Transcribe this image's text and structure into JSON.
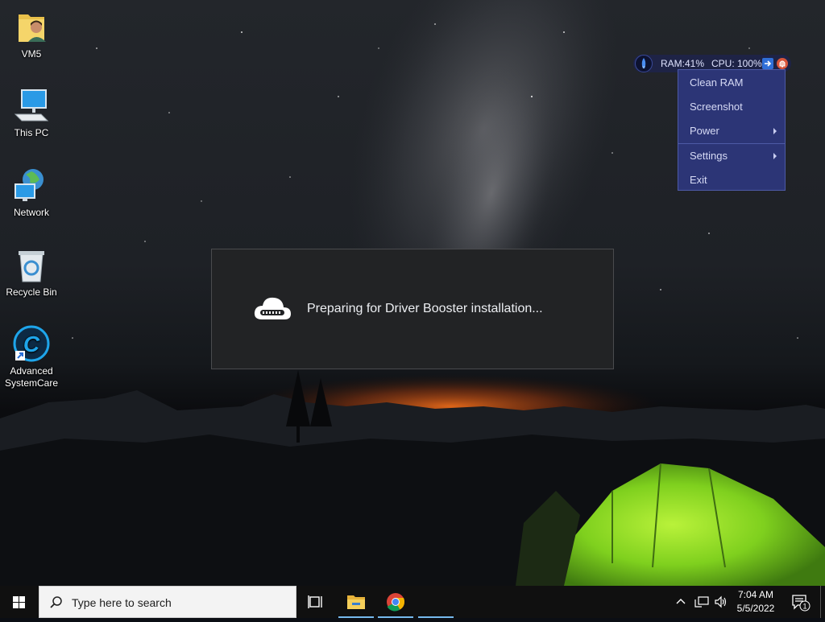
{
  "desktop": {
    "icons": [
      {
        "label": "VM5",
        "icon": "user-folder-icon"
      },
      {
        "label": "This PC",
        "icon": "computer-icon"
      },
      {
        "label": "Network",
        "icon": "network-globe-icon"
      },
      {
        "label": "Recycle Bin",
        "icon": "recycle-bin-icon"
      },
      {
        "label": "Advanced SystemCare",
        "icon": "advanced-systemcare-icon"
      }
    ]
  },
  "monitor": {
    "ram": "RAM:41%",
    "cpu": "CPU: 100%"
  },
  "context_menu": {
    "items": [
      {
        "label": "Clean RAM",
        "submenu": false
      },
      {
        "label": "Screenshot",
        "submenu": false
      },
      {
        "label": "Power",
        "submenu": true
      },
      {
        "label": "Settings",
        "submenu": true
      },
      {
        "label": "Exit",
        "submenu": false
      }
    ],
    "bg_color": "#2c3576"
  },
  "installer": {
    "message": "Preparing for Driver Booster installation..."
  },
  "taskbar": {
    "search_placeholder": "Type here to search",
    "apps": [
      "task-view",
      "file-explorer",
      "chrome"
    ],
    "clock_time": "7:04 AM",
    "clock_date": "5/5/2022",
    "notification_count": "1"
  }
}
